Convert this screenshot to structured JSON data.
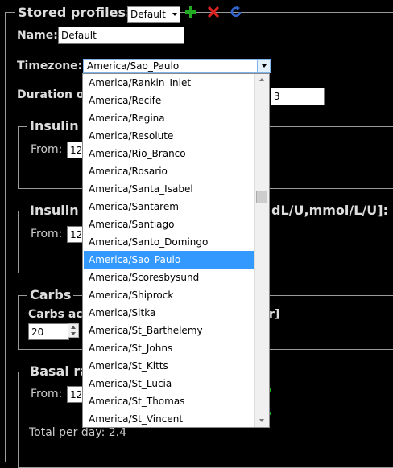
{
  "profiles": {
    "legend": "Stored profiles:",
    "selected_profile": "Default",
    "add_icon": "plus-icon",
    "delete_icon": "x-icon",
    "reload_icon": "refresh-icon"
  },
  "name": {
    "label": "Name:",
    "value": "Default"
  },
  "timezone": {
    "label": "Timezone:",
    "value": "America/Sao_Paulo",
    "options": [
      "America/Rankin_Inlet",
      "America/Recife",
      "America/Regina",
      "America/Resolute",
      "America/Rio_Branco",
      "America/Rosario",
      "America/Santa_Isabel",
      "America/Santarem",
      "America/Santiago",
      "America/Santo_Domingo",
      "America/Sao_Paulo",
      "America/Scoresbysund",
      "America/Shiprock",
      "America/Sitka",
      "America/St_Barthelemy",
      "America/St_Johns",
      "America/St_Kitts",
      "America/St_Lucia",
      "America/St_Thomas",
      "America/St_Vincent"
    ],
    "selected_index": 10
  },
  "duration": {
    "label_visible": "Duration o",
    "value": "3"
  },
  "insulin_to_carb": {
    "legend_visible": "Insulin t",
    "from_label": "From:",
    "from_value": "12"
  },
  "insulin_sensitivity": {
    "legend_visible": "Insulin s",
    "legend_tail": "dL/U,mmol/L/U]:",
    "from_label": "From:",
    "from_value": "12"
  },
  "carbs": {
    "legend": "Carbs",
    "activity_label_visible": "Carbs act",
    "activity_tail": "r]",
    "value": "20"
  },
  "basal": {
    "legend_visible": "Basal ra",
    "from_label": "From:",
    "from_value": "12",
    "total_label": "Total per day: 2.4"
  },
  "colors": {
    "accent": "#3399ff",
    "add": "#22aa22",
    "delete": "#dd2222",
    "reload": "#3366cc"
  }
}
